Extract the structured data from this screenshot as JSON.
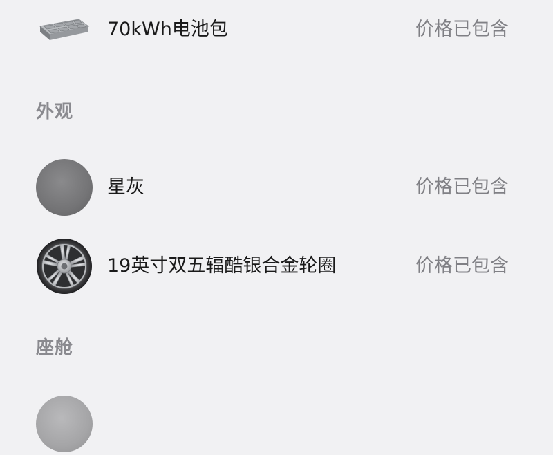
{
  "items": {
    "battery": {
      "label": "70kWh电池包",
      "status": "价格已包含",
      "icon": "battery-pack-icon"
    },
    "color": {
      "label": "星灰",
      "status": "价格已包含",
      "icon": "color-swatch-icon",
      "swatch_color": "#767678"
    },
    "wheel": {
      "label": "19英寸双五辐酷银合金轮圈",
      "status": "价格已包含",
      "icon": "wheel-rim-icon"
    }
  },
  "sections": {
    "exterior": "外观",
    "cabin": "座舱"
  },
  "colors": {
    "background": "#f1f1f3",
    "primary_text": "#1a1a1a",
    "secondary_text": "#808085",
    "heading_text": "#8a8a8f"
  }
}
